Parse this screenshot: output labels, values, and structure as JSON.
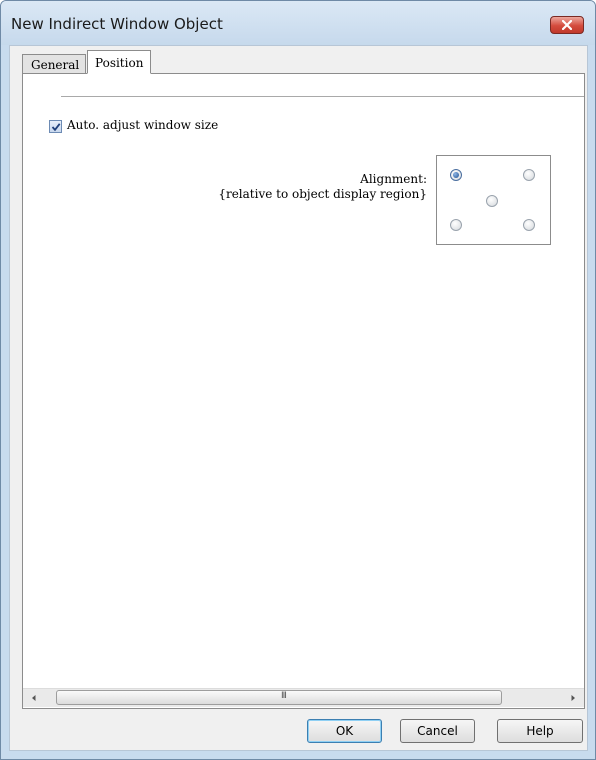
{
  "window": {
    "title": "New Indirect Window Object"
  },
  "tabs": [
    {
      "label": "General",
      "selected": false
    },
    {
      "label": "Position",
      "selected": true
    }
  ],
  "position_tab": {
    "auto_adjust": {
      "label": "Auto. adjust window size",
      "checked": true
    },
    "alignment": {
      "label": "Alignment:",
      "sublabel": "{relative to object display region}",
      "options": [
        "top-left",
        "top-right",
        "center",
        "bottom-left",
        "bottom-right"
      ],
      "selected": "top-left"
    }
  },
  "scrollbar": {
    "grip": "III"
  },
  "buttons": {
    "ok": "OK",
    "cancel": "Cancel",
    "help": "Help"
  },
  "icons": {
    "close": "close-icon",
    "check": "checkmark-icon",
    "scroll_left": "arrow-left-icon",
    "scroll_right": "arrow-right-icon"
  },
  "colors": {
    "close_button": "#d44b3d",
    "title_bar": "#c6d9ec",
    "ok_focus": "#3c7fb1"
  }
}
